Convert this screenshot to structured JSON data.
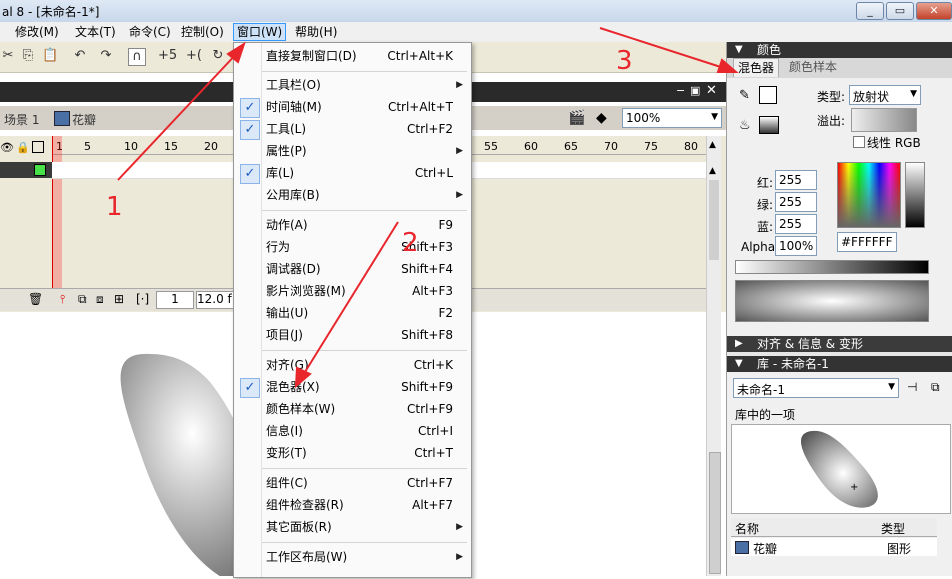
{
  "window": {
    "title": "al 8 - [未命名-1*]",
    "controls": [
      "_",
      "▭",
      "✕"
    ]
  },
  "menubar": {
    "items": [
      "修改(M)",
      "文本(T)",
      "命令(C)",
      "控制(O)",
      "窗口(W)",
      "帮助(H)"
    ]
  },
  "timeline": {
    "scene_label": "场景 1",
    "symbol_label": "花瓣",
    "zoom": "100%",
    "frame_numbers": [
      "1",
      "5",
      "10",
      "15",
      "20",
      "55",
      "60",
      "65",
      "70",
      "75",
      "80"
    ],
    "current_frame": "1",
    "fps": "12.0 f"
  },
  "dropdown": {
    "items": [
      {
        "label": "直接复制窗口(D)",
        "shortcut": "Ctrl+Alt+K",
        "check": false,
        "submenu": false
      },
      {
        "label": "工具栏(O)",
        "shortcut": "",
        "check": false,
        "submenu": true
      },
      {
        "label": "时间轴(M)",
        "shortcut": "Ctrl+Alt+T",
        "check": true,
        "submenu": false
      },
      {
        "label": "工具(L)",
        "shortcut": "Ctrl+F2",
        "check": true,
        "submenu": false
      },
      {
        "label": "属性(P)",
        "shortcut": "",
        "check": false,
        "submenu": true
      },
      {
        "label": "库(L)",
        "shortcut": "Ctrl+L",
        "check": true,
        "submenu": false
      },
      {
        "label": "公用库(B)",
        "shortcut": "",
        "check": false,
        "submenu": true
      },
      {
        "label": "动作(A)",
        "shortcut": "F9",
        "check": false,
        "submenu": false
      },
      {
        "label": "行为",
        "shortcut": "Shift+F3",
        "check": false,
        "submenu": false
      },
      {
        "label": "调试器(D)",
        "shortcut": "Shift+F4",
        "check": false,
        "submenu": false
      },
      {
        "label": "影片浏览器(M)",
        "shortcut": "Alt+F3",
        "check": false,
        "submenu": false
      },
      {
        "label": "输出(U)",
        "shortcut": "F2",
        "check": false,
        "submenu": false
      },
      {
        "label": "项目(J)",
        "shortcut": "Shift+F8",
        "check": false,
        "submenu": false
      },
      {
        "label": "对齐(G)",
        "shortcut": "Ctrl+K",
        "check": false,
        "submenu": false
      },
      {
        "label": "混色器(X)",
        "shortcut": "Shift+F9",
        "check": true,
        "submenu": false
      },
      {
        "label": "颜色样本(W)",
        "shortcut": "Ctrl+F9",
        "check": false,
        "submenu": false
      },
      {
        "label": "信息(I)",
        "shortcut": "Ctrl+I",
        "check": false,
        "submenu": false
      },
      {
        "label": "变形(T)",
        "shortcut": "Ctrl+T",
        "check": false,
        "submenu": false
      },
      {
        "label": "组件(C)",
        "shortcut": "Ctrl+F7",
        "check": false,
        "submenu": false
      },
      {
        "label": "组件检查器(R)",
        "shortcut": "Alt+F7",
        "check": false,
        "submenu": false
      },
      {
        "label": "其它面板(R)",
        "shortcut": "",
        "check": false,
        "submenu": true
      },
      {
        "label": "工作区布局(W)",
        "shortcut": "",
        "check": false,
        "submenu": true
      }
    ]
  },
  "color_panel": {
    "title": "颜色",
    "tab_mixer": "混色器",
    "tab_swatches": "颜色样本",
    "type_label": "类型:",
    "type_value": "放射状",
    "overflow_label": "溢出:",
    "linear_rgb_label": "线性 RGB",
    "red_label": "红:",
    "red_value": "255",
    "green_label": "绿:",
    "green_value": "255",
    "blue_label": "蓝:",
    "blue_value": "255",
    "alpha_label": "Alpha:",
    "alpha_value": "100%",
    "hex_value": "#FFFFFF"
  },
  "align_panel": {
    "title": "对齐 & 信息 & 变形"
  },
  "library_panel": {
    "title": "库 - 未命名-1",
    "doc_select": "未命名-1",
    "item_count": "库中的一项",
    "col_name": "名称",
    "col_type": "类型",
    "row_name": "花瓣",
    "row_type": "图形"
  },
  "annotations": {
    "num1": "1",
    "num2": "2",
    "num3": "3"
  }
}
